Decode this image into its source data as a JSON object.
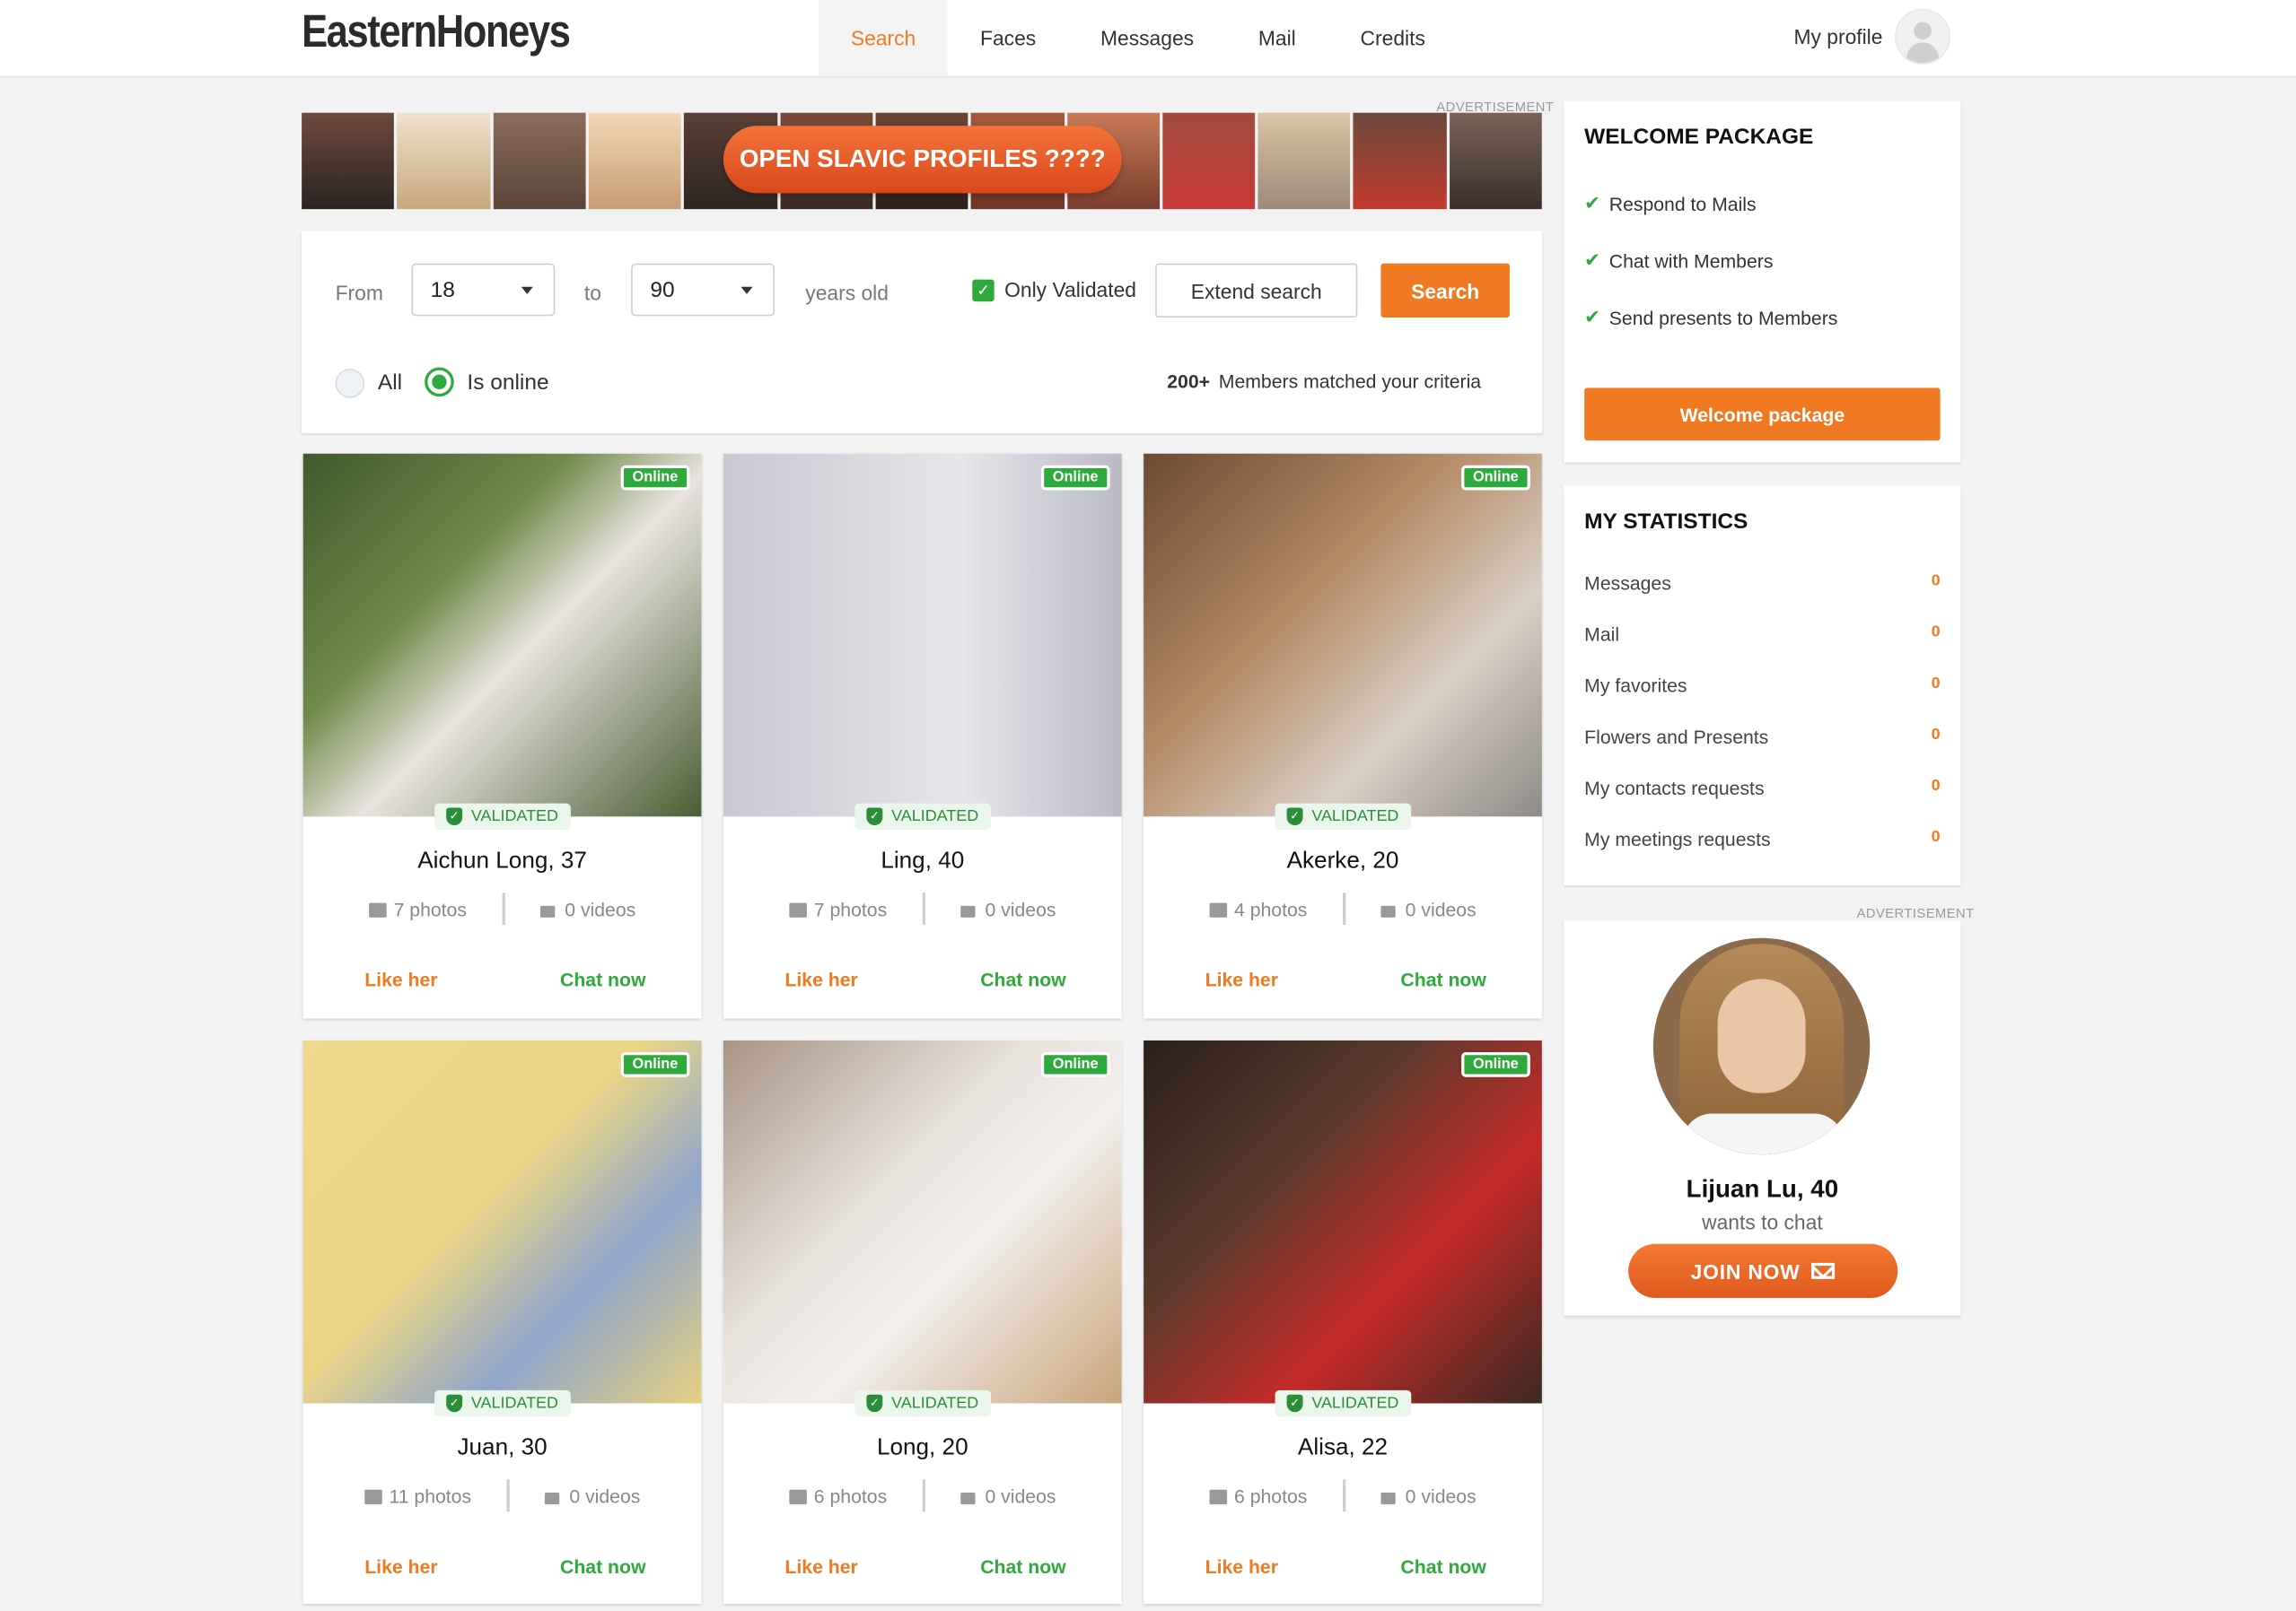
{
  "header": {
    "logo": "EasternHoneys",
    "nav": [
      "Search",
      "Faces",
      "Messages",
      "Mail",
      "Credits"
    ],
    "my_profile": "My profile"
  },
  "ad_banner": {
    "label": "ADVERTISEMENT",
    "button": "OPEN SLAVIC PROFILES ????"
  },
  "filter": {
    "from_label": "From",
    "from_value": "18",
    "to_label": "to",
    "to_value": "90",
    "years_label": "years old",
    "only_validated": "Only Validated",
    "extend_search": "Extend search",
    "search_button": "Search",
    "radio_all": "All",
    "radio_online": "Is online",
    "matched_count": "200+",
    "matched_text": "Members matched your criteria"
  },
  "cards": [
    {
      "name": "Aichun Long, 37",
      "photos": "7 photos",
      "videos": "0 videos",
      "badge": "Online",
      "validated": "VALIDATED",
      "like": "Like her",
      "chat": "Chat now"
    },
    {
      "name": "Ling, 40",
      "photos": "7 photos",
      "videos": "0 videos",
      "badge": "Online",
      "validated": "VALIDATED",
      "like": "Like her",
      "chat": "Chat now"
    },
    {
      "name": "Akerke, 20",
      "photos": "4 photos",
      "videos": "0 videos",
      "badge": "Online",
      "validated": "VALIDATED",
      "like": "Like her",
      "chat": "Chat now"
    },
    {
      "name": "Juan, 30",
      "photos": "11 photos",
      "videos": "0 videos",
      "badge": "Online",
      "validated": "VALIDATED",
      "like": "Like her",
      "chat": "Chat now"
    },
    {
      "name": "Long, 20",
      "photos": "6 photos",
      "videos": "0 videos",
      "badge": "Online",
      "validated": "VALIDATED",
      "like": "Like her",
      "chat": "Chat now"
    },
    {
      "name": "Alisa, 22",
      "photos": "6 photos",
      "videos": "0 videos",
      "badge": "Online",
      "validated": "VALIDATED",
      "like": "Like her",
      "chat": "Chat now"
    }
  ],
  "welcome": {
    "title": "WELCOME PACKAGE",
    "items": [
      "Respond to Mails",
      "Chat with Members",
      "Send presents to Members"
    ],
    "button": "Welcome package"
  },
  "statistics": {
    "title": "MY STATISTICS",
    "rows": [
      {
        "label": "Messages",
        "value": "0"
      },
      {
        "label": "Mail",
        "value": "0"
      },
      {
        "label": "My favorites",
        "value": "0"
      },
      {
        "label": "Flowers and Presents",
        "value": "0"
      },
      {
        "label": "My contacts requests",
        "value": "0"
      },
      {
        "label": "My meetings requests",
        "value": "0"
      }
    ]
  },
  "side_ad": {
    "label": "ADVERTISEMENT",
    "name": "Lijuan Lu, 40",
    "subtitle": "wants to chat",
    "button": "JOIN NOW"
  },
  "colors": {
    "accent": "#f07a21",
    "online_green": "#2eaa3c",
    "validated_green": "#2b8d38",
    "background": "#f2f2f2"
  }
}
